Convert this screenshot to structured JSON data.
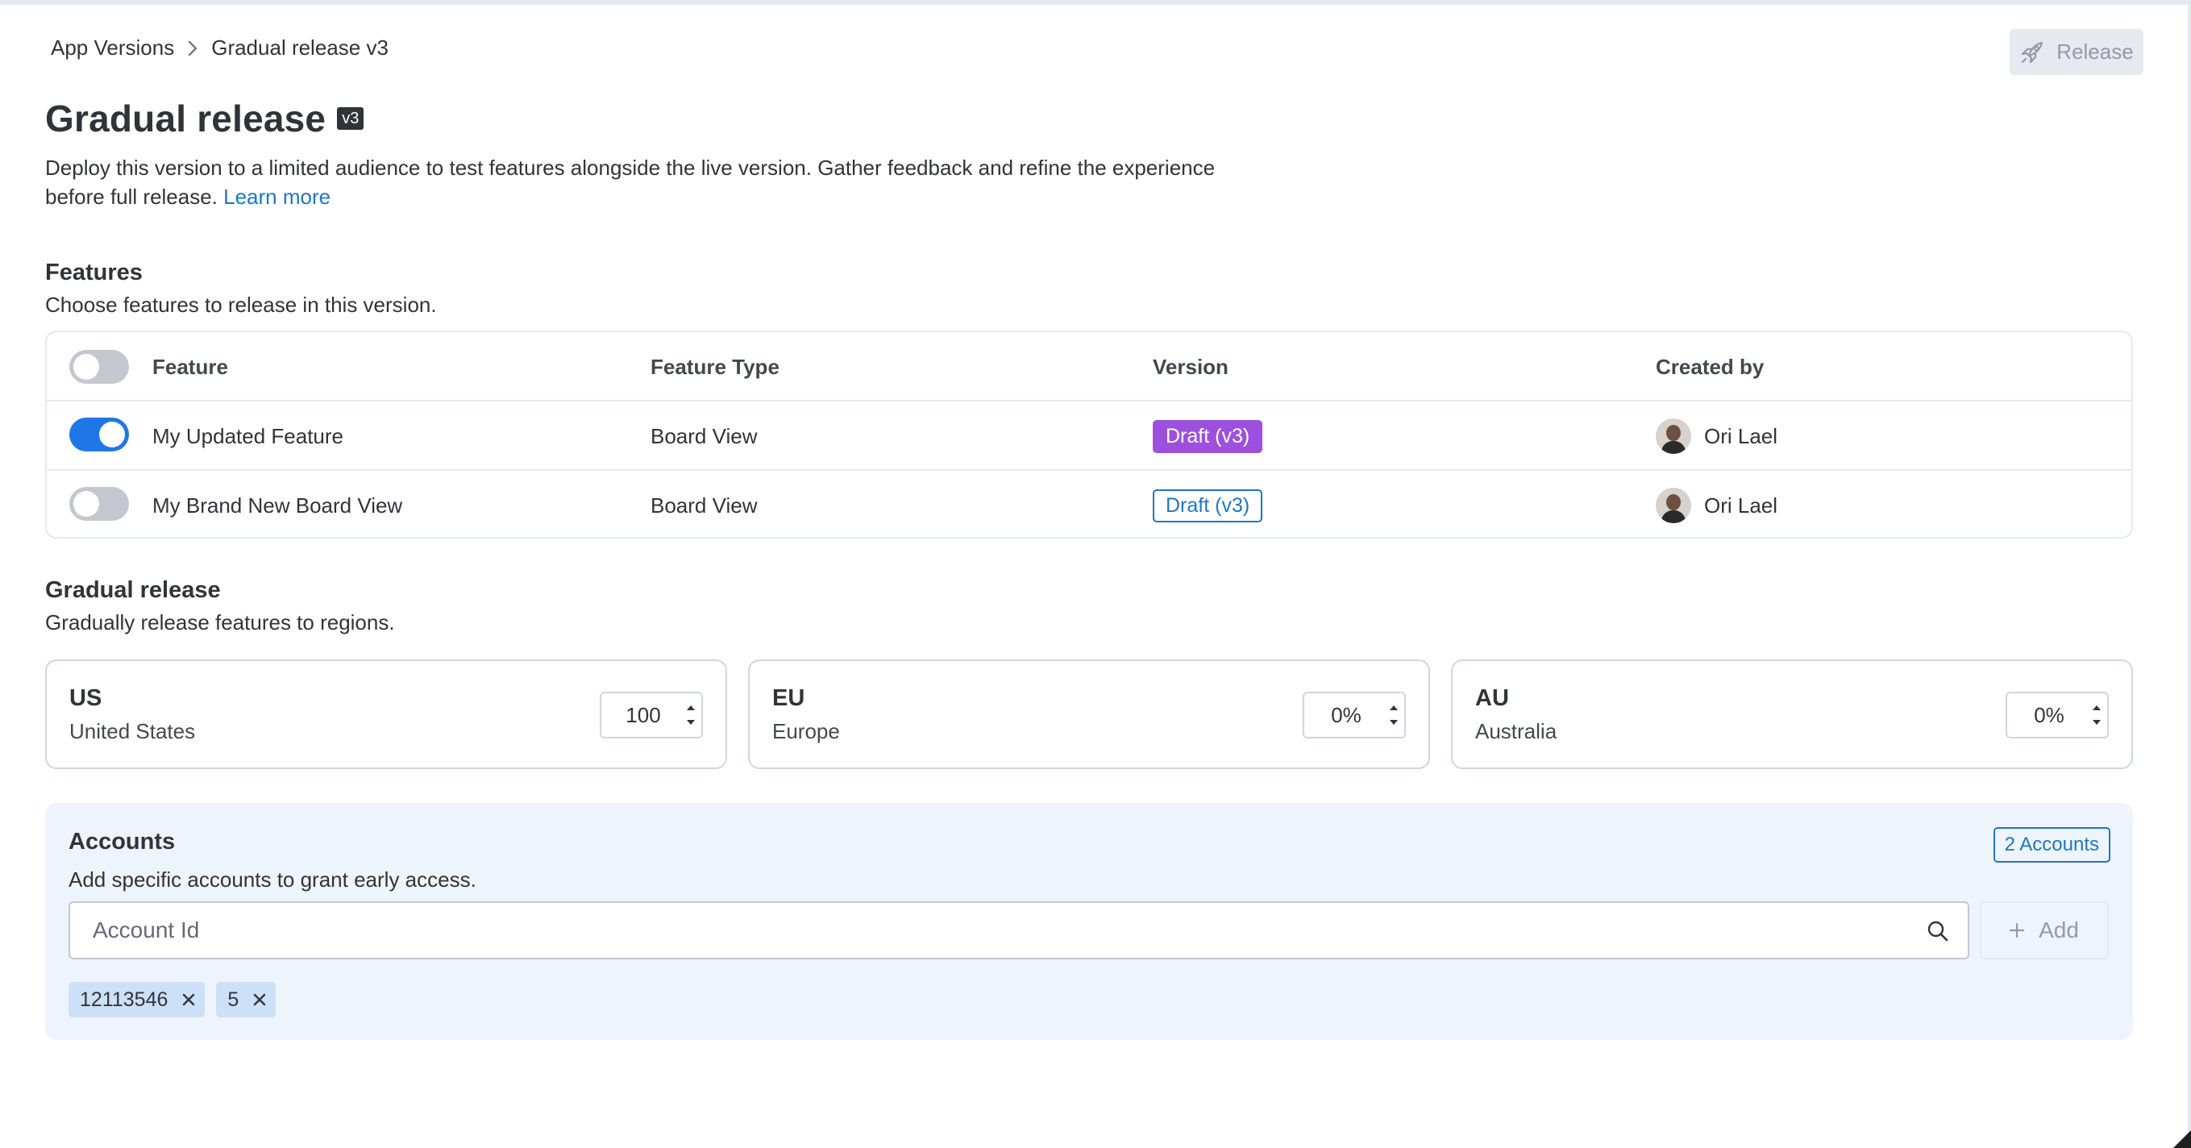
{
  "breadcrumb": {
    "parent": "App Versions",
    "current": "Gradual release v3"
  },
  "release_button": {
    "label": "Release"
  },
  "header": {
    "title": "Gradual release",
    "version_badge": "v3",
    "description": "Deploy this version to a limited audience to test features alongside the live version. Gather feedback and refine the experience before full release.",
    "learn_more": "Learn more"
  },
  "features": {
    "title": "Features",
    "subtitle": "Choose features to release in this version.",
    "columns": [
      "Feature",
      "Feature Type",
      "Version",
      "Created by"
    ],
    "select_all_enabled": false,
    "rows": [
      {
        "enabled": true,
        "name": "My Updated Feature",
        "type": "Board View",
        "version": "Draft (v3)",
        "version_style": "filled",
        "created_by": "Ori Lael"
      },
      {
        "enabled": false,
        "name": "My Brand New Board View",
        "type": "Board View",
        "version": "Draft (v3)",
        "version_style": "outline",
        "created_by": "Ori Lael"
      }
    ]
  },
  "gradual_release": {
    "title": "Gradual release",
    "subtitle": "Gradually release features to regions.",
    "regions": [
      {
        "code": "US",
        "name": "United States",
        "value": "100"
      },
      {
        "code": "EU",
        "name": "Europe",
        "value": "0%"
      },
      {
        "code": "AU",
        "name": "Australia",
        "value": "0%"
      }
    ]
  },
  "accounts": {
    "title": "Accounts",
    "subtitle": "Add specific accounts to grant early access.",
    "count_badge": "2 Accounts",
    "input_placeholder": "Account Id",
    "add_label": "Add",
    "chips": [
      "12113546",
      "5"
    ]
  },
  "colors": {
    "primary": "#1f76e6",
    "link": "#1f76c2",
    "draft_purple": "#9d50dd",
    "accounts_bg": "#eef4fc"
  },
  "icons": [
    "chevron-right-icon",
    "rocket-icon",
    "search-icon",
    "plus-icon",
    "close-icon",
    "stepper-up-icon",
    "stepper-down-icon"
  ]
}
